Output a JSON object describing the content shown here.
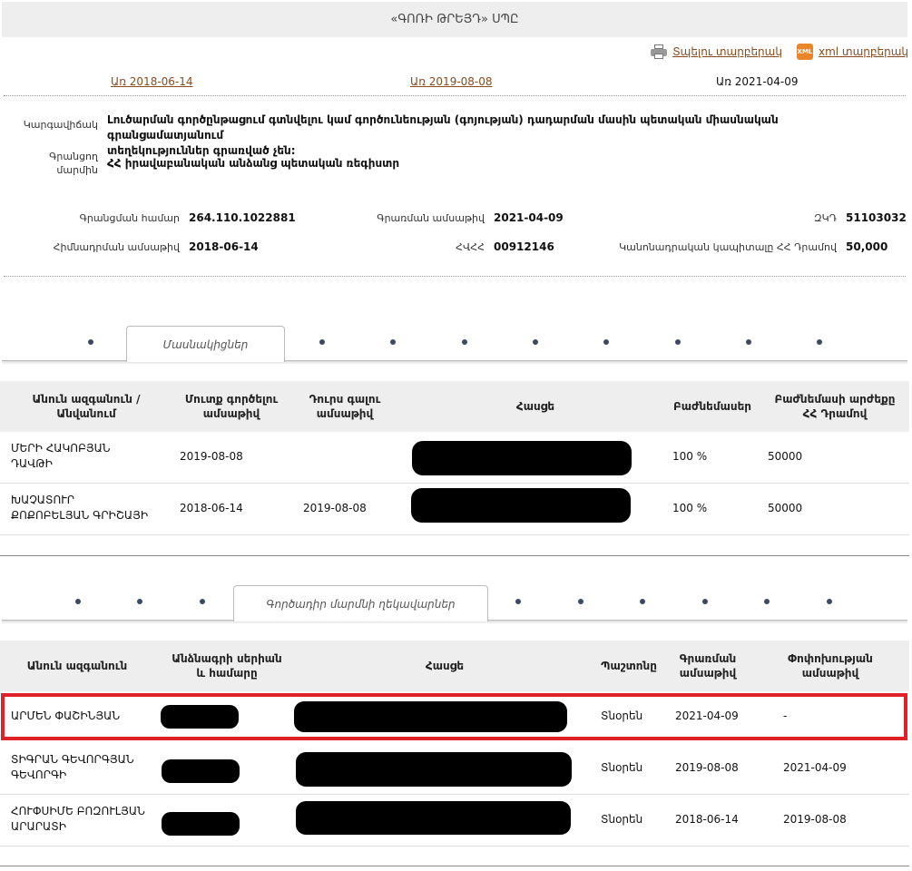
{
  "title": "«ԳՈՌԻ ԹՐԵՅԴ» ՍՊԸ",
  "actions": {
    "print_label": "Տպելու տարբերակ",
    "xml_label": "xml տարբերակ",
    "xml_icon_text": "XML"
  },
  "date_tabs": [
    {
      "label": "Առ 2018-06-14",
      "active": false
    },
    {
      "label": "Առ 2019-08-08",
      "active": false
    },
    {
      "label": "Առ 2021-04-09",
      "active": true
    }
  ],
  "status": {
    "label": "Կարգավիճակ",
    "value_line1": "Լուծարման գործընթացում գտնվելու կամ գործունեության (գոյության) դադարման մասին պետական միասնական գրանցամատյանում",
    "value_line2": "տեղեկություններ գրառված չեն:"
  },
  "registrar": {
    "label_line1": "Գրանցող",
    "label_line2": "մարմին",
    "value": "ՀՀ իրավաբանական անձանց պետական ռեգիստր"
  },
  "meta": {
    "reg_number_label": "Գրանցման համար",
    "reg_number": "264.110.1022881",
    "reg_date_label": "Գրառման ամսաթիվ",
    "reg_date": "2021-04-09",
    "zkd_label": "ԶԿԴ",
    "zkd": "51103032",
    "found_date_label": "Հիմնադրման ամսաթիվ",
    "found_date": "2018-06-14",
    "tin_label": "ՀՎՀՀ",
    "tin": "00912146",
    "capital_label": "Կանոնադրական կապիտալը ՀՀ Դրամով",
    "capital": "50,000"
  },
  "participants_tab": "Մասնակիցներ",
  "participants": {
    "headers": [
      "Անուն ազգանուն /",
      "Անվանում",
      "Մուտք գործելու",
      "ամսաթիվ",
      "Դուրս գալու",
      "ամսաթիվ",
      "Հասցե",
      "Բաժնեմասեր",
      "Բաժնեմասի արժեքը",
      "ՀՀ Դրամով"
    ],
    "rows": [
      {
        "name1": "ՄԵՐԻ ՀԱԿՈԲՅԱՆ",
        "name2": "ԴԱՎԹԻ",
        "entry": "2019-08-08",
        "exit": "",
        "share": "100 %",
        "value": "50000"
      },
      {
        "name1": "ԽԱՉԱՏՈՒՐ",
        "name2": "ՔՈՔՈԲԵԼՅԱՆ ԳՐԻՇԱՅԻ",
        "entry": "2018-06-14",
        "exit": "2019-08-08",
        "share": "100 %",
        "value": "50000"
      }
    ]
  },
  "managers_tab": "Գործադիր մարմնի ղեկավարներ",
  "managers": {
    "headers": [
      "Անուն ազգանուն",
      "Անձնագրի սերիան",
      "և համարը",
      "Հասցե",
      "Պաշտոնը",
      "Գրառման",
      "ամսաթիվ",
      "Փոփոխության",
      "ամսաթիվ"
    ],
    "rows": [
      {
        "name1": "ԱՐՄԵՆ ՓԱՇԻՆՅԱՆ",
        "name2": "",
        "position": "Տնօրեն",
        "date": "2021-04-09",
        "change": "-"
      },
      {
        "name1": "ՏԻԳՐԱՆ ԳԵՎՈՐԳՅԱՆ",
        "name2": "ԳԵՎՈՐԳԻ",
        "position": "Տնօրեն",
        "date": "2019-08-08",
        "change": "2021-04-09"
      },
      {
        "name1": "ՀՈՒՓՍԻՄԵ ԲՈԶՈՒԼՅԱՆ",
        "name2": "ԱՐԱՐԱՏԻ",
        "position": "Տնօրեն",
        "date": "2018-06-14",
        "change": "2019-08-08"
      }
    ]
  }
}
